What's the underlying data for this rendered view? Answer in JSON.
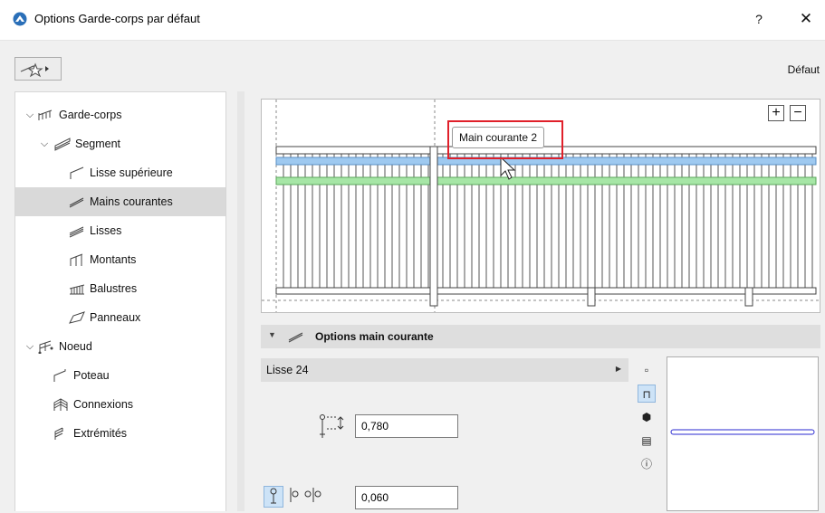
{
  "window": {
    "title": "Options Garde-corps par défaut",
    "help_label": "?",
    "close_label": "✕"
  },
  "toolbar": {
    "favorites_icon": "favorites-star-icon",
    "preset_label": "Défaut"
  },
  "tree": {
    "items": [
      {
        "label": "Garde-corps",
        "icon": "railing-icon",
        "expanded": true
      },
      {
        "label": "Segment",
        "icon": "segment-icon",
        "expanded": true
      },
      {
        "label": "Lisse supérieure",
        "icon": "top-rail-icon"
      },
      {
        "label": "Mains courantes",
        "icon": "handrail-icon",
        "selected": true
      },
      {
        "label": "Lisses",
        "icon": "rails-icon"
      },
      {
        "label": "Montants",
        "icon": "posts-icon"
      },
      {
        "label": "Balustres",
        "icon": "balusters-icon"
      },
      {
        "label": "Panneaux",
        "icon": "panels-icon"
      },
      {
        "label": "Noeud",
        "icon": "node-icon",
        "expanded": true
      },
      {
        "label": "Poteau",
        "icon": "post-icon"
      },
      {
        "label": "Connexions",
        "icon": "connections-icon"
      },
      {
        "label": "Extrémités",
        "icon": "ends-icon"
      }
    ]
  },
  "preview": {
    "zoom_in": "+",
    "zoom_out": "−",
    "tooltip": "Main courante 2"
  },
  "section": {
    "title": "Options main courante"
  },
  "profile": {
    "value": "Lisse 24"
  },
  "height_field": {
    "value": "0,780"
  },
  "offset_field": {
    "value": "0,060"
  },
  "side_tools": [
    {
      "icon": "plain-profile-icon"
    },
    {
      "icon": "handrail-profile-icon",
      "active": true
    },
    {
      "icon": "material-cube-icon"
    },
    {
      "icon": "ends-settings-icon"
    },
    {
      "icon": "info-icon"
    }
  ],
  "colors": {
    "accent_highlight": "#e0202a",
    "selected_rail": "#9ec9f0",
    "green_rail": "#a6e6a6",
    "tree_selection": "#d9d9d9"
  }
}
